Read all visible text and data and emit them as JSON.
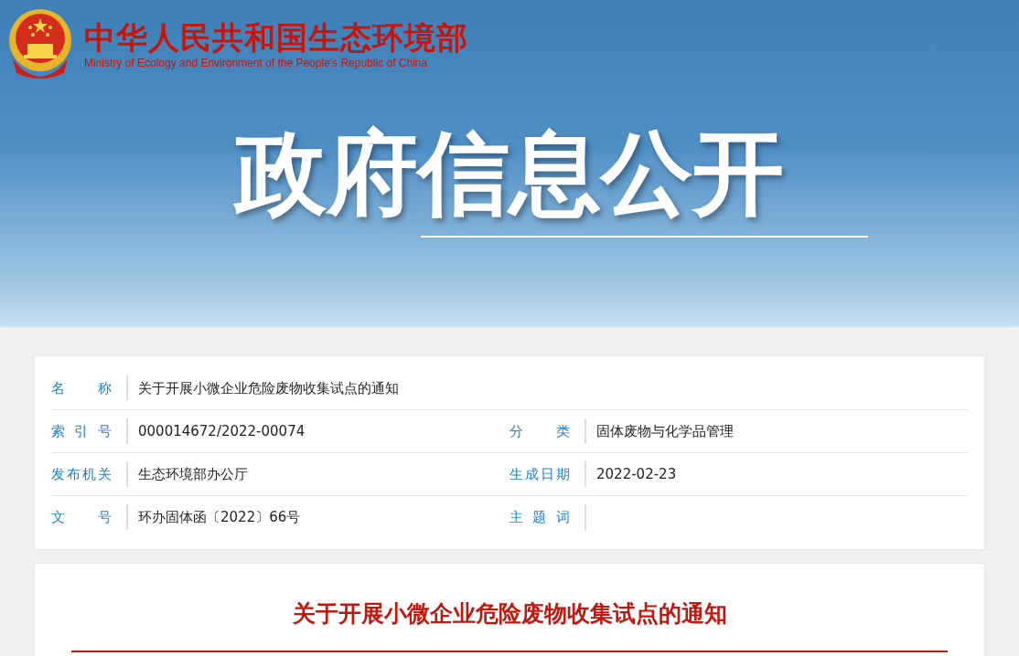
{
  "header": {
    "title": "中华人民共和国生态环境部",
    "subtitle": "Ministry of Ecology and Environment of the People's Republic of China"
  },
  "banner": {
    "title": "政府信息公开"
  },
  "info_rows": [
    {
      "fields": [
        {
          "label": "名 称",
          "value": "关于开展小微企业危险废物收集试点的通知"
        }
      ]
    },
    {
      "fields": [
        {
          "label": "索 引 号",
          "value": "000014672/2022-00074"
        },
        {
          "label": "分 类",
          "value": "固体废物与化学品管理"
        }
      ]
    },
    {
      "fields": [
        {
          "label": "发布机关",
          "value": "生态环境部办公厅"
        },
        {
          "label": "生成日期",
          "value": "2022-02-23"
        }
      ]
    },
    {
      "fields": [
        {
          "label": "文 号",
          "value": "环办固体函〔2022〕66号"
        },
        {
          "label": "主 题 词"
        }
      ]
    }
  ],
  "article": {
    "title": "关于开展小微企业危险废物收集试点的通知"
  }
}
